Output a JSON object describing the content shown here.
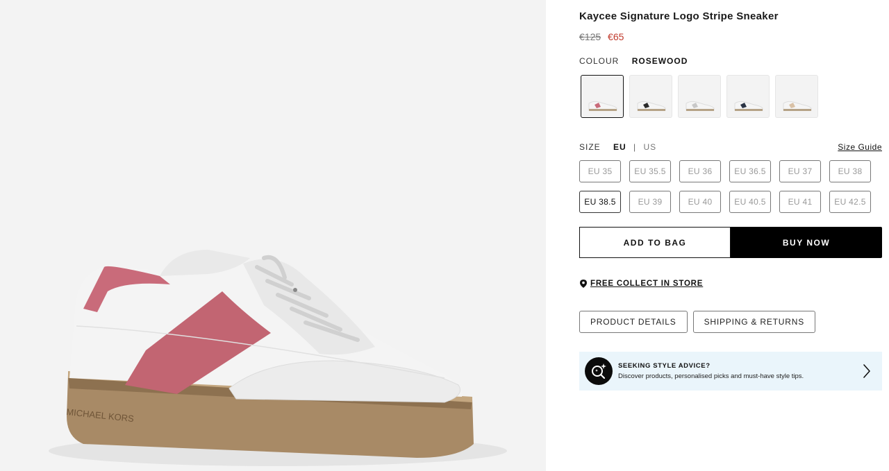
{
  "product": {
    "title": "Kaycee Signature Logo Stripe Sneaker",
    "price_old": "€125",
    "price_new": "€65",
    "brand_mark": "MICHAEL KORS"
  },
  "colour": {
    "label": "COLOUR",
    "value": "ROSEWOOD",
    "swatches": [
      {
        "name": "rosewood",
        "accent": "#c96b7a"
      },
      {
        "name": "black",
        "accent": "#2a2a2a"
      },
      {
        "name": "light-grey",
        "accent": "#c8c8c8"
      },
      {
        "name": "navy",
        "accent": "#2b3445"
      },
      {
        "name": "beige",
        "accent": "#d9c1a6"
      }
    ]
  },
  "size": {
    "label": "SIZE",
    "system_selected": "EU",
    "separator": "|",
    "system_other": "US",
    "guide_label": "Size Guide",
    "options": [
      {
        "label": "EU 35",
        "available": false
      },
      {
        "label": "EU 35.5",
        "available": false
      },
      {
        "label": "EU 36",
        "available": false
      },
      {
        "label": "EU 36.5",
        "available": false
      },
      {
        "label": "EU 37",
        "available": false
      },
      {
        "label": "EU 38",
        "available": false
      },
      {
        "label": "EU 38.5",
        "available": true
      },
      {
        "label": "EU 39",
        "available": false
      },
      {
        "label": "EU 40",
        "available": false
      },
      {
        "label": "EU 40.5",
        "available": false
      },
      {
        "label": "EU 41",
        "available": false
      },
      {
        "label": "EU 42.5",
        "available": false
      }
    ]
  },
  "actions": {
    "add_to_bag": "ADD TO BAG",
    "buy_now": "BUY NOW"
  },
  "collect": {
    "label": "FREE COLLECT IN STORE",
    "icon": "location-pin-icon"
  },
  "tabs": {
    "product_details": "PRODUCT DETAILS",
    "shipping_returns": "SHIPPING & RETURNS"
  },
  "advice": {
    "title": "SEEKING STYLE ADVICE?",
    "subtitle": "Discover products, personalised picks and must-have style tips.",
    "icon": "search-sparkle-icon"
  },
  "colors": {
    "accent_red": "#c0392b",
    "advice_bg": "#eaf5fb",
    "rosewood": "#c96b7a",
    "sole": "#a88a66"
  }
}
